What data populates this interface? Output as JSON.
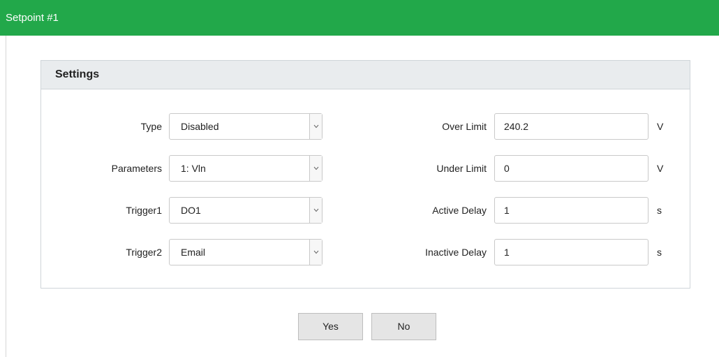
{
  "window": {
    "title": "Setpoint #1"
  },
  "settings": {
    "header": "Settings",
    "left_fields": [
      {
        "label": "Type",
        "value": "Disabled"
      },
      {
        "label": "Parameters",
        "value": "1: Vln"
      },
      {
        "label": "Trigger1",
        "value": "DO1"
      },
      {
        "label": "Trigger2",
        "value": "Email"
      }
    ],
    "right_fields": [
      {
        "label": "Over Limit",
        "value": "240.2",
        "unit": "V"
      },
      {
        "label": "Under Limit",
        "value": "0",
        "unit": "V"
      },
      {
        "label": "Active Delay",
        "value": "1",
        "unit": "s"
      },
      {
        "label": "Inactive Delay",
        "value": "1",
        "unit": "s"
      }
    ]
  },
  "buttons": {
    "yes": "Yes",
    "no": "No"
  },
  "colors": {
    "titlebar": "#22a84a",
    "panel_header": "#e9ecee"
  }
}
